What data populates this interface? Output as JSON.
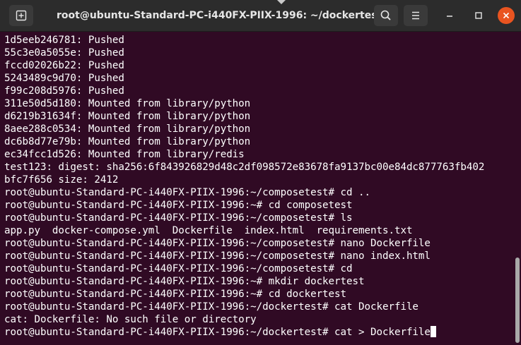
{
  "window": {
    "title": "root@ubuntu-Standard-PC-i440FX-PIIX-1996: ~/dockertest"
  },
  "colors": {
    "terminal_background": "#300a24",
    "titlebar": "#2c2c2c",
    "close_button": "#e95420",
    "text": "#ffffff"
  },
  "icons": {
    "new_tab": "new-tab-icon",
    "search": "search-icon",
    "menu": "hamburger-menu-icon",
    "minimize": "minimize-icon",
    "maximize": "maximize-icon",
    "close": "close-icon"
  },
  "terminal": {
    "lines": [
      "1d5eeb246781: Pushed",
      "55c3e0a5055e: Pushed",
      "fccd02026b22: Pushed",
      "5243489c9d70: Pushed",
      "f99c208d5976: Pushed",
      "311e50d5d180: Mounted from library/python",
      "d6219b31634f: Mounted from library/python",
      "8aee288c0534: Mounted from library/python",
      "dc6b8d77e79b: Mounted from library/python",
      "ec34fcc1d526: Mounted from library/redis",
      "test123: digest: sha256:6f843926829d48c2df098572e83678fa9137bc00e84dc877763fb402",
      "bfc7f656 size: 2412",
      "root@ubuntu-Standard-PC-i440FX-PIIX-1996:~/composetest# cd ..",
      "root@ubuntu-Standard-PC-i440FX-PIIX-1996:~# cd composetest",
      "root@ubuntu-Standard-PC-i440FX-PIIX-1996:~/composetest# ls",
      "app.py  docker-compose.yml  Dockerfile  index.html  requirements.txt",
      "root@ubuntu-Standard-PC-i440FX-PIIX-1996:~/composetest# nano Dockerfile",
      "root@ubuntu-Standard-PC-i440FX-PIIX-1996:~/composetest# nano index.html",
      "root@ubuntu-Standard-PC-i440FX-PIIX-1996:~/composetest# cd",
      "root@ubuntu-Standard-PC-i440FX-PIIX-1996:~# mkdir dockertest",
      "root@ubuntu-Standard-PC-i440FX-PIIX-1996:~# cd dockertest",
      "root@ubuntu-Standard-PC-i440FX-PIIX-1996:~/dockertest# cat Dockerfile",
      "cat: Dockerfile: No such file or directory",
      "root@ubuntu-Standard-PC-i440FX-PIIX-1996:~/dockertest# cat > Dockerfile"
    ]
  }
}
